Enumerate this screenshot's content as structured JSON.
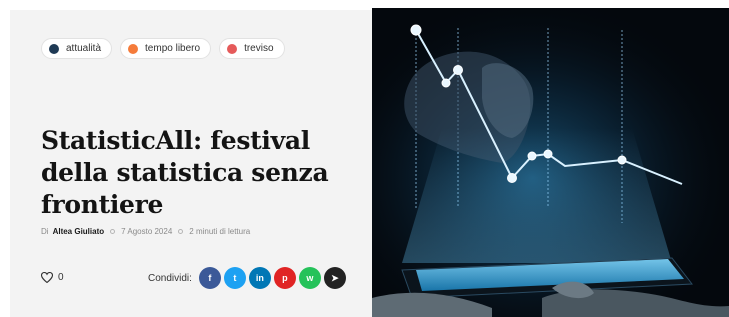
{
  "tags": [
    {
      "label": "attualità",
      "color": "#1f3a55"
    },
    {
      "label": "tempo libero",
      "color": "#f57b3a"
    },
    {
      "label": "treviso",
      "color": "#e55a5a"
    }
  ],
  "article": {
    "title_line1": "StatisticAll: festival",
    "title_line2": "della statistica senza",
    "title_line3": "frontiere",
    "by_prefix": "Di",
    "author": "Altea Giuliato",
    "date": "7 Agosto 2024",
    "read_time": "2 minuti di lettura"
  },
  "likes": {
    "count": "0",
    "icon": "heart-icon"
  },
  "share": {
    "label": "Condividi:",
    "buttons": [
      {
        "name": "facebook",
        "glyph": "f",
        "color": "#3b5998"
      },
      {
        "name": "twitter",
        "glyph": "t",
        "color": "#1da1f2"
      },
      {
        "name": "linkedin",
        "glyph": "in",
        "color": "#0077b5"
      },
      {
        "name": "pinterest",
        "glyph": "p",
        "color": "#e02424"
      },
      {
        "name": "whatsapp",
        "glyph": "w",
        "color": "#25c25a"
      },
      {
        "name": "telegram",
        "glyph": "➤",
        "color": "#222222"
      }
    ]
  },
  "hero": {
    "description_icon": "hand-holding-tablet-with-line-chart-image"
  }
}
